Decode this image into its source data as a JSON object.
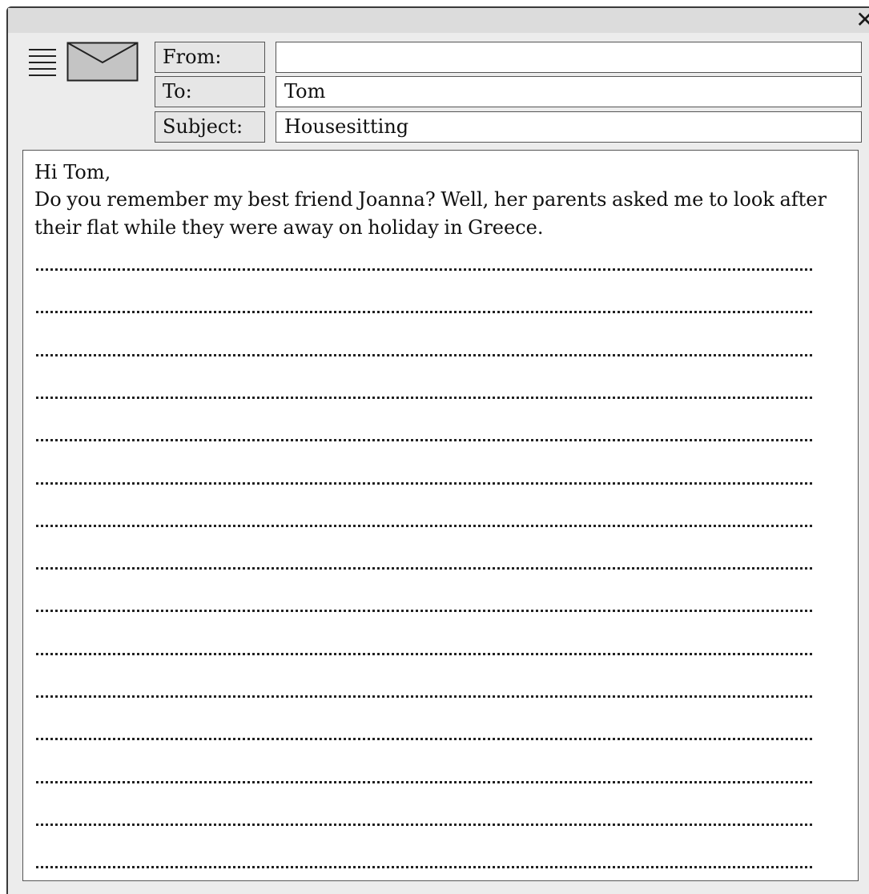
{
  "window": {
    "close_glyph": "✕"
  },
  "icons": {
    "menu": "menu-icon",
    "envelope": "envelope-icon",
    "close": "close-icon"
  },
  "header": {
    "from_label": "From:",
    "from_value": "",
    "to_label": "To:",
    "to_value": "Tom",
    "subject_label": "Subject:",
    "subject_value": "Housesitting"
  },
  "body": {
    "greeting": "Hi Tom,",
    "text": "Do you remember my best friend Joanna? Well, her parents asked me to look after their flat while they were away on holiday in Greece.",
    "answer_lines": 15
  },
  "colors": {
    "window_background": "#ececec",
    "titlebar": "#dcdcdc",
    "label_background": "#e6e6e6",
    "envelope_fill": "#c4c4c4"
  }
}
